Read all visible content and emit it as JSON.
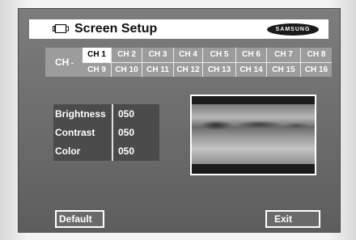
{
  "header": {
    "title": "Screen Setup",
    "icon": "monitor-icon",
    "brand_logo": "SAMSUNG"
  },
  "channel_selector": {
    "label": "CH",
    "selected": "CH 1",
    "channels": [
      "CH 1",
      "CH 2",
      "CH 3",
      "CH 4",
      "CH 5",
      "CH 6",
      "CH 7",
      "CH 8",
      "CH 9",
      "CH 10",
      "CH 11",
      "CH 12",
      "CH 13",
      "CH 14",
      "CH 15",
      "CH 16"
    ]
  },
  "settings": [
    {
      "label": "Brightness",
      "value": "050"
    },
    {
      "label": "Contrast",
      "value": "050"
    },
    {
      "label": "Color",
      "value": "050"
    }
  ],
  "buttons": {
    "default_label": "Default",
    "exit_label": "Exit"
  },
  "colors": {
    "panel_bg": "#6b6b6b",
    "selected_bg": "#ffffff",
    "grid_bg": "#9c9c9c"
  }
}
